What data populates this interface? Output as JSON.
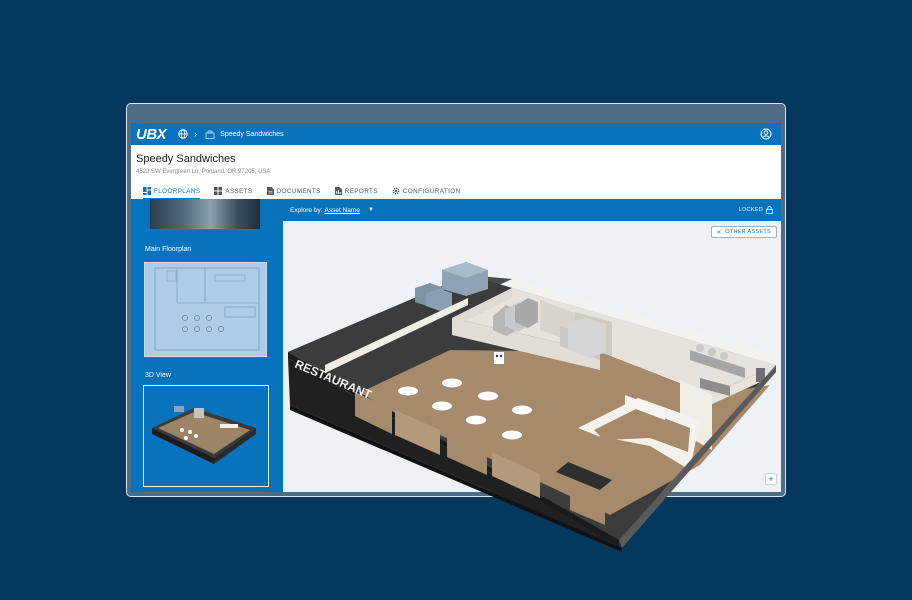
{
  "brand": {
    "logo_text": "UBX"
  },
  "breadcrumb": {
    "site_label": "Speedy Sandwiches"
  },
  "site": {
    "title": "Speedy Sandwiches",
    "address": "4523 SW Evergreen Ln, Portland, OR 97205, USA"
  },
  "tabs": [
    {
      "label": "FLOORPLANS",
      "icon": "grid-icon",
      "active": true
    },
    {
      "label": "ASSETS",
      "icon": "cubes-icon",
      "active": false
    },
    {
      "label": "DOCUMENTS",
      "icon": "document-icon",
      "active": false
    },
    {
      "label": "REPORTS",
      "icon": "report-icon",
      "active": false
    },
    {
      "label": "CONFIGURATION",
      "icon": "gear-icon",
      "active": false
    }
  ],
  "sidebar": {
    "floorplan_label": "Main Floorplan",
    "view3d_label": "3D View"
  },
  "toolbar": {
    "explore_label": "Explore by:",
    "explore_value": "Asset Name",
    "lock_status": "LOCKED"
  },
  "viewer": {
    "other_assets_label": "OTHER ASSETS",
    "zoom_in_label": "+",
    "storefront_sign": "RESTAURANT"
  },
  "colors": {
    "page_background": "#04385c",
    "brand_blue": "#0873bd",
    "floor_wood": "#a58a6b",
    "wall": "#e7e3dc"
  }
}
